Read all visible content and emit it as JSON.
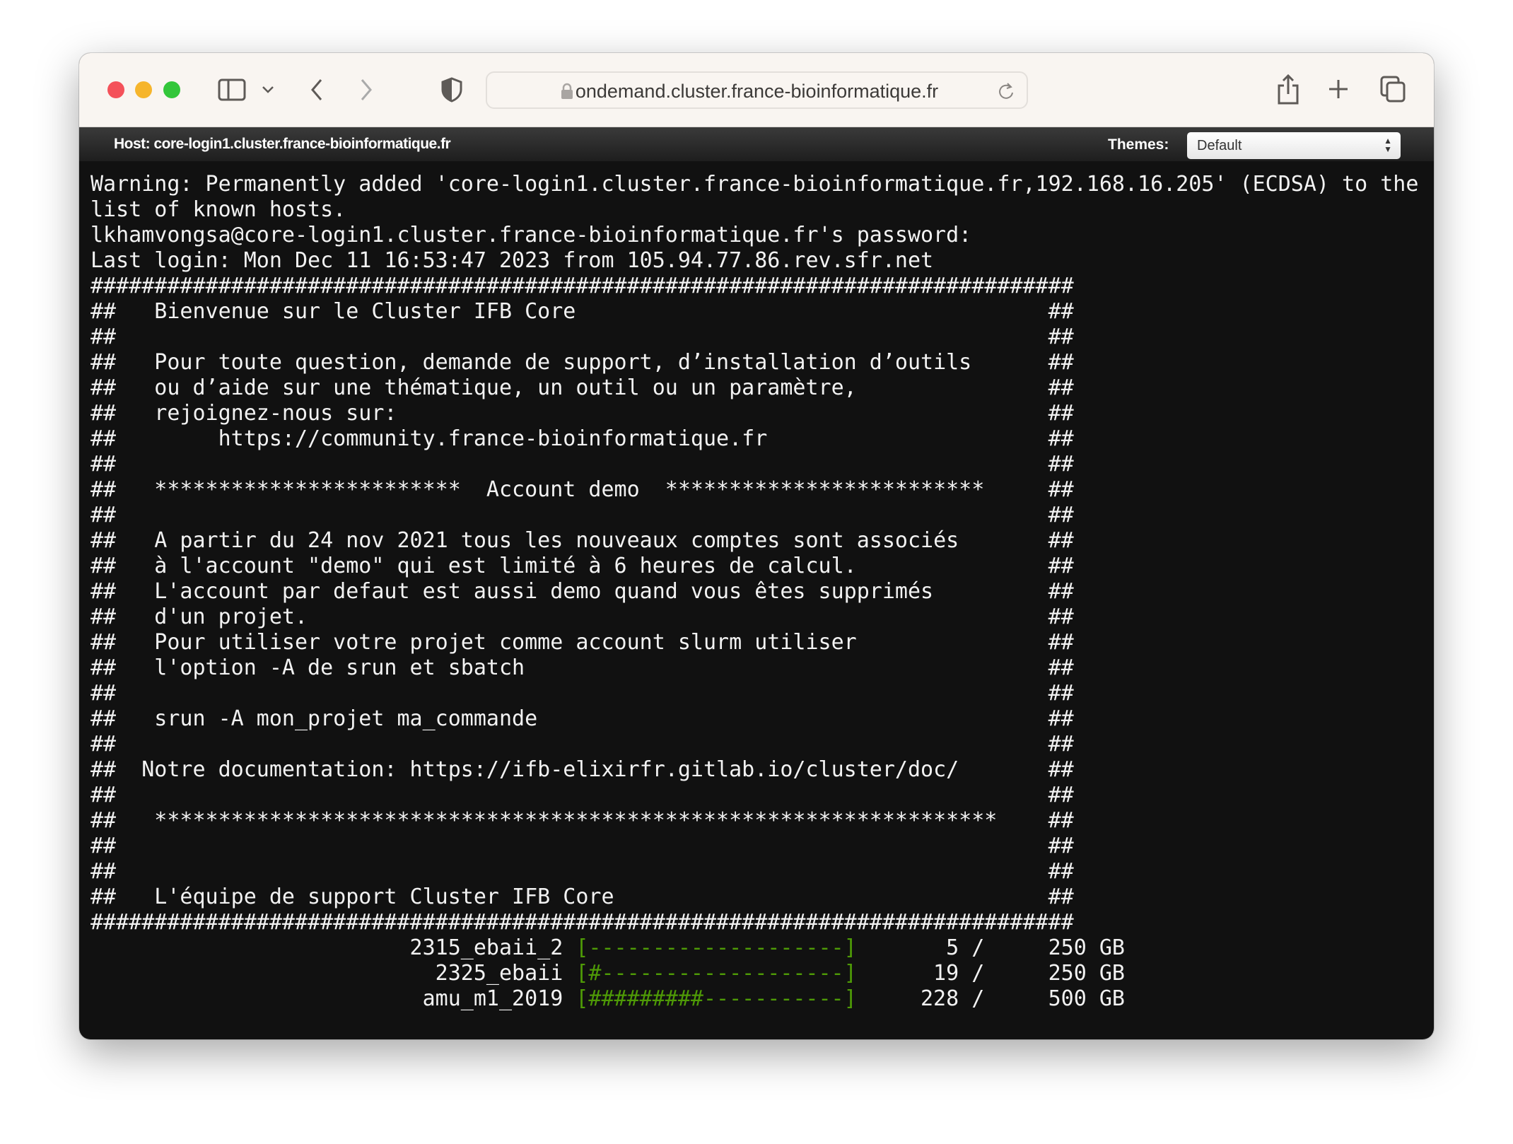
{
  "browser": {
    "url": "ondemand.cluster.france-bioinformatique.fr",
    "icons": [
      "sidebar-icon",
      "chevron-down-icon",
      "back-icon",
      "forward-icon",
      "shield-icon",
      "lock-icon",
      "reload-icon",
      "share-icon",
      "new-tab-icon",
      "tabs-icon"
    ]
  },
  "header": {
    "host": "Host: core-login1.cluster.france-bioinformatique.fr",
    "themes_label": "Themes:",
    "theme_selected": "Default"
  },
  "terminal": {
    "intro": [
      "Warning: Permanently added 'core-login1.cluster.france-bioinformatique.fr,192.168.16.205' (ECDSA) to the",
      "list of known hosts.",
      "lkhamvongsa@core-login1.cluster.france-bioinformatique.fr's password:",
      "Last login: Mon Dec 11 16:53:47 2023 from 105.94.77.86.rev.sfr.net"
    ],
    "border": "#############################################################################",
    "box_prefix": "##",
    "box_suffix": "##",
    "box_lines": [
      "   Bienvenue sur le Cluster IFB Core",
      "",
      "   Pour toute question, demande de support, d’installation d’outils",
      "   ou d’aide sur une thématique, un outil ou un paramètre,",
      "   rejoignez-nous sur:",
      "        https://community.france-bioinformatique.fr",
      "",
      "   ************************  Account demo  *************************",
      "",
      "   A partir du 24 nov 2021 tous les nouveaux comptes sont associés",
      "   à l'account \"demo\" qui est limité à 6 heures de calcul.",
      "   L'account par defaut est aussi demo quand vous êtes supprimés",
      "   d'un projet.",
      "   Pour utiliser votre projet comme account slurm utiliser",
      "   l'option -A de srun et sbatch",
      "",
      "   srun -A mon_projet ma_commande",
      "",
      "  Notre documentation: https://ifb-elixirfr.gitlab.io/cluster/doc/",
      "",
      "   ******************************************************************",
      "",
      "",
      "   L'équipe de support Cluster IFB Core"
    ],
    "storage": [
      {
        "name": "2315_ebaii_2",
        "bar": "[--------------------]",
        "used": "5 /",
        "total": "250 GB"
      },
      {
        "name": "2325_ebaii",
        "bar": "[#-------------------]",
        "used": "19 /",
        "total": "250 GB"
      },
      {
        "name": "amu_m1_2019",
        "bar": "[#########-----------]",
        "used": "228 /",
        "total": "500 GB"
      }
    ]
  },
  "colors": {
    "bar": "#4e9a06",
    "background": "#111111"
  }
}
